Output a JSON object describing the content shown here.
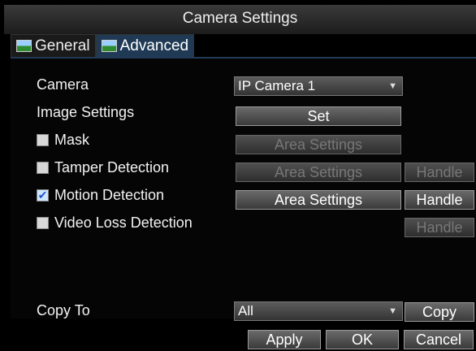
{
  "window": {
    "title": "Camera Settings"
  },
  "tabs": [
    {
      "label": "General",
      "active": false
    },
    {
      "label": "Advanced",
      "active": true
    }
  ],
  "fields": {
    "camera": {
      "label": "Camera",
      "value": "IP Camera 1"
    },
    "image_settings": {
      "label": "Image Settings",
      "button": "Set"
    },
    "mask": {
      "label": "Mask",
      "checked": false,
      "area_button": "Area Settings"
    },
    "tamper": {
      "label": "Tamper Detection",
      "checked": false,
      "area_button": "Area Settings",
      "handle_button": "Handle"
    },
    "motion": {
      "label": "Motion Detection",
      "checked": true,
      "area_button": "Area Settings",
      "handle_button": "Handle"
    },
    "video_loss": {
      "label": "Video Loss Detection",
      "checked": false,
      "handle_button": "Handle"
    },
    "copy_to": {
      "label": "Copy To",
      "value": "All",
      "button": "Copy"
    }
  },
  "footer": {
    "apply": "Apply",
    "ok": "OK",
    "cancel": "Cancel"
  },
  "colors": {
    "tab_active": "#203a55",
    "panel_border": "#223a55",
    "checkbox_mark": "#2255cc"
  }
}
